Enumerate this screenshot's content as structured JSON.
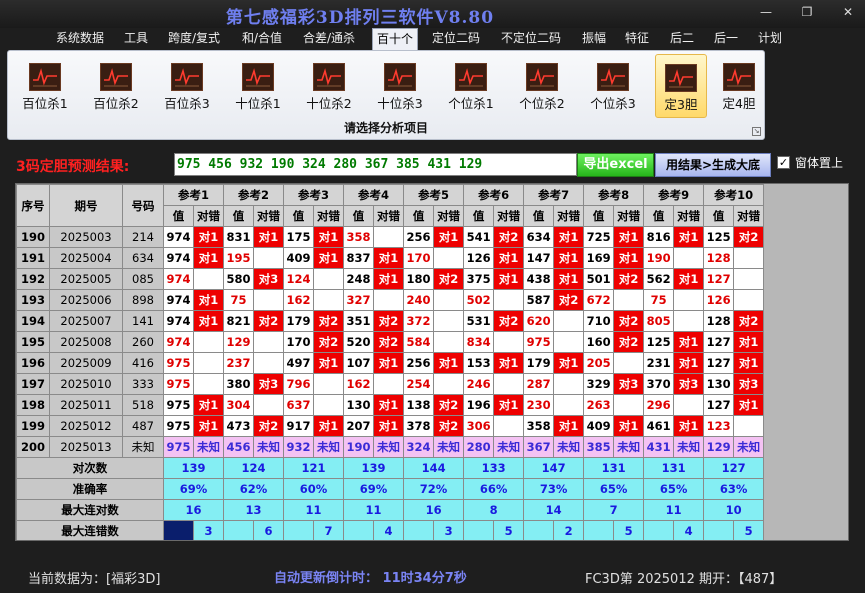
{
  "window": {
    "title": "第七感福彩3D排列三软件V8.80",
    "minimize": "—",
    "restore": "❐",
    "close": "✕"
  },
  "menu": [
    "系统数据",
    "工具",
    "跨度/复式",
    "和/合值",
    "合差/通杀",
    "百十个",
    "定位二码",
    "不定位二码",
    "振幅",
    "特征",
    "后二",
    "后一",
    "计划"
  ],
  "menu_active_index": 5,
  "ribbon": {
    "buttons": [
      "百位杀1",
      "百位杀2",
      "百位杀3",
      "十位杀1",
      "十位杀2",
      "十位杀3",
      "个位杀1",
      "个位杀2",
      "个位杀3",
      "定3胆",
      "定4胆"
    ],
    "active_index": 9,
    "caption": "请选择分析项目"
  },
  "result": {
    "label": "3码定胆预测结果:",
    "value": "975 456 932 190 324 280 367 385 431 129",
    "excel_button": "导出excel",
    "generate_button": "用结果>生成大底",
    "topmost_checked": true,
    "topmost_label": "窗体置上"
  },
  "table": {
    "col_idx": "序号",
    "col_period": "期号",
    "col_num": "号码",
    "ref_headers": [
      "参考1",
      "参考2",
      "参考3",
      "参考4",
      "参考5",
      "参考6",
      "参考7",
      "参考8",
      "参考9",
      "参考10"
    ],
    "sub_value": "值",
    "sub_match": "对错",
    "rows": [
      {
        "idx": "190",
        "period": "2025003",
        "num": "214",
        "c": [
          [
            "974",
            "对1",
            0
          ],
          [
            "831",
            "对1",
            0
          ],
          [
            "175",
            "对1",
            0
          ],
          [
            "358",
            "",
            1
          ],
          [
            "256",
            "对1",
            0
          ],
          [
            "541",
            "对2",
            0
          ],
          [
            "634",
            "对1",
            0
          ],
          [
            "725",
            "对1",
            0
          ],
          [
            "816",
            "对1",
            0
          ],
          [
            "125",
            "对2",
            0
          ]
        ]
      },
      {
        "idx": "191",
        "period": "2025004",
        "num": "634",
        "c": [
          [
            "974",
            "对1",
            0
          ],
          [
            "195",
            "",
            1
          ],
          [
            "409",
            "对1",
            0
          ],
          [
            "837",
            "对1",
            0
          ],
          [
            "170",
            "",
            1
          ],
          [
            "126",
            "对1",
            0
          ],
          [
            "147",
            "对1",
            0
          ],
          [
            "169",
            "对1",
            0
          ],
          [
            "190",
            "",
            1
          ],
          [
            "128",
            "",
            1
          ]
        ]
      },
      {
        "idx": "192",
        "period": "2025005",
        "num": "085",
        "c": [
          [
            "974",
            "",
            1
          ],
          [
            "580",
            "对3",
            0
          ],
          [
            "124",
            "",
            1
          ],
          [
            "248",
            "对1",
            0
          ],
          [
            "180",
            "对2",
            0
          ],
          [
            "375",
            "对1",
            0
          ],
          [
            "438",
            "对1",
            0
          ],
          [
            "501",
            "对2",
            0
          ],
          [
            "562",
            "对1",
            0
          ],
          [
            "127",
            "",
            1
          ]
        ]
      },
      {
        "idx": "193",
        "period": "2025006",
        "num": "898",
        "c": [
          [
            "974",
            "对1",
            0
          ],
          [
            "75",
            "",
            1
          ],
          [
            "162",
            "",
            1
          ],
          [
            "327",
            "",
            1
          ],
          [
            "240",
            "",
            1
          ],
          [
            "502",
            "",
            1
          ],
          [
            "587",
            "对2",
            0
          ],
          [
            "672",
            "",
            1
          ],
          [
            "75",
            "",
            1
          ],
          [
            "126",
            "",
            1
          ]
        ]
      },
      {
        "idx": "194",
        "period": "2025007",
        "num": "141",
        "c": [
          [
            "974",
            "对1",
            0
          ],
          [
            "821",
            "对2",
            0
          ],
          [
            "179",
            "对2",
            0
          ],
          [
            "351",
            "对2",
            0
          ],
          [
            "372",
            "",
            1
          ],
          [
            "531",
            "对2",
            0
          ],
          [
            "620",
            "",
            1
          ],
          [
            "710",
            "对2",
            0
          ],
          [
            "805",
            "",
            1
          ],
          [
            "128",
            "对2",
            0
          ]
        ]
      },
      {
        "idx": "195",
        "period": "2025008",
        "num": "260",
        "c": [
          [
            "974",
            "",
            1
          ],
          [
            "129",
            "",
            1
          ],
          [
            "170",
            "对2",
            0
          ],
          [
            "520",
            "对2",
            0
          ],
          [
            "584",
            "",
            1
          ],
          [
            "834",
            "",
            1
          ],
          [
            "975",
            "",
            1
          ],
          [
            "160",
            "对2",
            0
          ],
          [
            "125",
            "对1",
            0
          ],
          [
            "127",
            "对1",
            0
          ]
        ]
      },
      {
        "idx": "196",
        "period": "2025009",
        "num": "416",
        "c": [
          [
            "975",
            "",
            1
          ],
          [
            "237",
            "",
            1
          ],
          [
            "497",
            "对1",
            0
          ],
          [
            "107",
            "对1",
            0
          ],
          [
            "256",
            "对1",
            0
          ],
          [
            "153",
            "对1",
            0
          ],
          [
            "179",
            "对1",
            0
          ],
          [
            "205",
            "",
            1
          ],
          [
            "231",
            "对1",
            0
          ],
          [
            "127",
            "对1",
            0
          ]
        ]
      },
      {
        "idx": "197",
        "period": "2025010",
        "num": "333",
        "c": [
          [
            "975",
            "",
            1
          ],
          [
            "380",
            "对3",
            0
          ],
          [
            "796",
            "",
            1
          ],
          [
            "162",
            "",
            1
          ],
          [
            "254",
            "",
            1
          ],
          [
            "246",
            "",
            1
          ],
          [
            "287",
            "",
            1
          ],
          [
            "329",
            "对3",
            0
          ],
          [
            "370",
            "对3",
            0
          ],
          [
            "130",
            "对3",
            0
          ]
        ]
      },
      {
        "idx": "198",
        "period": "2025011",
        "num": "518",
        "c": [
          [
            "975",
            "对1",
            0
          ],
          [
            "304",
            "",
            1
          ],
          [
            "637",
            "",
            1
          ],
          [
            "130",
            "对1",
            0
          ],
          [
            "138",
            "对2",
            0
          ],
          [
            "196",
            "对1",
            0
          ],
          [
            "230",
            "",
            1
          ],
          [
            "263",
            "",
            1
          ],
          [
            "296",
            "",
            1
          ],
          [
            "127",
            "对1",
            0
          ]
        ]
      },
      {
        "idx": "199",
        "period": "2025012",
        "num": "487",
        "c": [
          [
            "975",
            "对1",
            0
          ],
          [
            "473",
            "对2",
            0
          ],
          [
            "917",
            "对1",
            0
          ],
          [
            "207",
            "对1",
            0
          ],
          [
            "378",
            "对2",
            0
          ],
          [
            "306",
            "",
            1
          ],
          [
            "358",
            "对1",
            0
          ],
          [
            "409",
            "对1",
            0
          ],
          [
            "461",
            "对1",
            0
          ],
          [
            "123",
            "",
            1
          ]
        ]
      }
    ],
    "prediction_row": {
      "idx": "200",
      "period": "2025013",
      "num": "未知",
      "c": [
        [
          "975",
          "未知"
        ],
        [
          "456",
          "未知"
        ],
        [
          "932",
          "未知"
        ],
        [
          "190",
          "未知"
        ],
        [
          "324",
          "未知"
        ],
        [
          "280",
          "未知"
        ],
        [
          "367",
          "未知"
        ],
        [
          "385",
          "未知"
        ],
        [
          "431",
          "未知"
        ],
        [
          "129",
          "未知"
        ]
      ]
    },
    "stats": [
      {
        "label": "对次数",
        "values": [
          "139",
          "124",
          "121",
          "139",
          "144",
          "133",
          "147",
          "131",
          "131",
          "127"
        ]
      },
      {
        "label": "准确率",
        "values": [
          "69%",
          "62%",
          "60%",
          "69%",
          "72%",
          "66%",
          "73%",
          "65%",
          "65%",
          "63%"
        ]
      },
      {
        "label": "最大连对数",
        "values": [
          "16",
          "13",
          "11",
          "11",
          "16",
          "8",
          "14",
          "7",
          "11",
          "10"
        ]
      },
      {
        "label": "最大连错数",
        "values": [
          "3",
          "6",
          "7",
          "4",
          "3",
          "5",
          "2",
          "5",
          "4",
          "5"
        ]
      }
    ]
  },
  "status": {
    "current_data": "当前数据为：[福彩3D]",
    "countdown": "自动更新倒计时：  11时34分7秒",
    "period_info": "FC3D第 2025012 期开：【487】"
  },
  "colors": {
    "hit": "#ee0000",
    "cyan": "#84eef3",
    "pink": "#f4c2f3",
    "title": "#6f7ff0"
  }
}
